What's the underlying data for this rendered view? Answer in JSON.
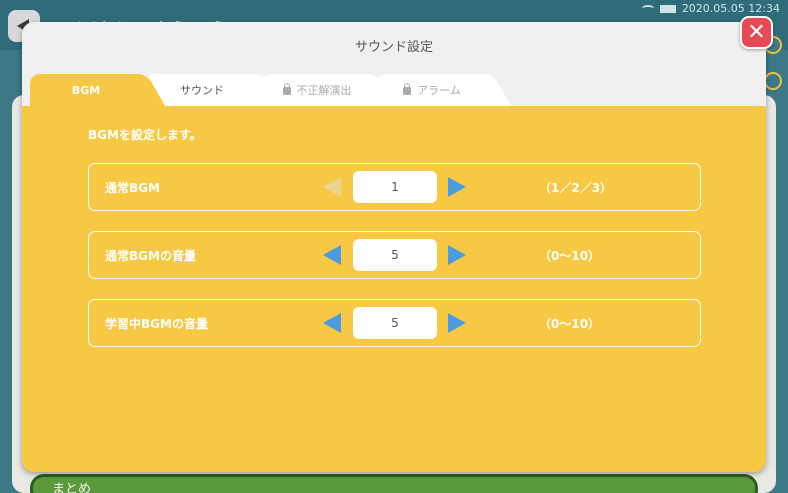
{
  "background": {
    "status_time": "2020.05.05  12:34",
    "title": "てんけん・ゆうこう",
    "bottom_label": "まとめ"
  },
  "dialog": {
    "title": "サウンド設定",
    "close_label": "✕"
  },
  "tabs": [
    {
      "label": "BGM",
      "active": true,
      "locked": false
    },
    {
      "label": "サウンド",
      "active": false,
      "locked": false
    },
    {
      "label": "不正解演出",
      "active": false,
      "locked": true
    },
    {
      "label": "アラーム",
      "active": false,
      "locked": true
    }
  ],
  "intro": "BGMを設定します。",
  "rows": [
    {
      "label": "通常BGM",
      "value": "1",
      "range": "（1／2／3）",
      "left_disabled": true
    },
    {
      "label": "通常BGMの音量",
      "value": "5",
      "range": "（0〜10）",
      "left_disabled": false
    },
    {
      "label": "学習中BGMの音量",
      "value": "5",
      "range": "（0〜10）",
      "left_disabled": false
    }
  ],
  "colors": {
    "accent": "#f6c843",
    "arrow": "#4a9be0",
    "close": "#e84a55"
  }
}
